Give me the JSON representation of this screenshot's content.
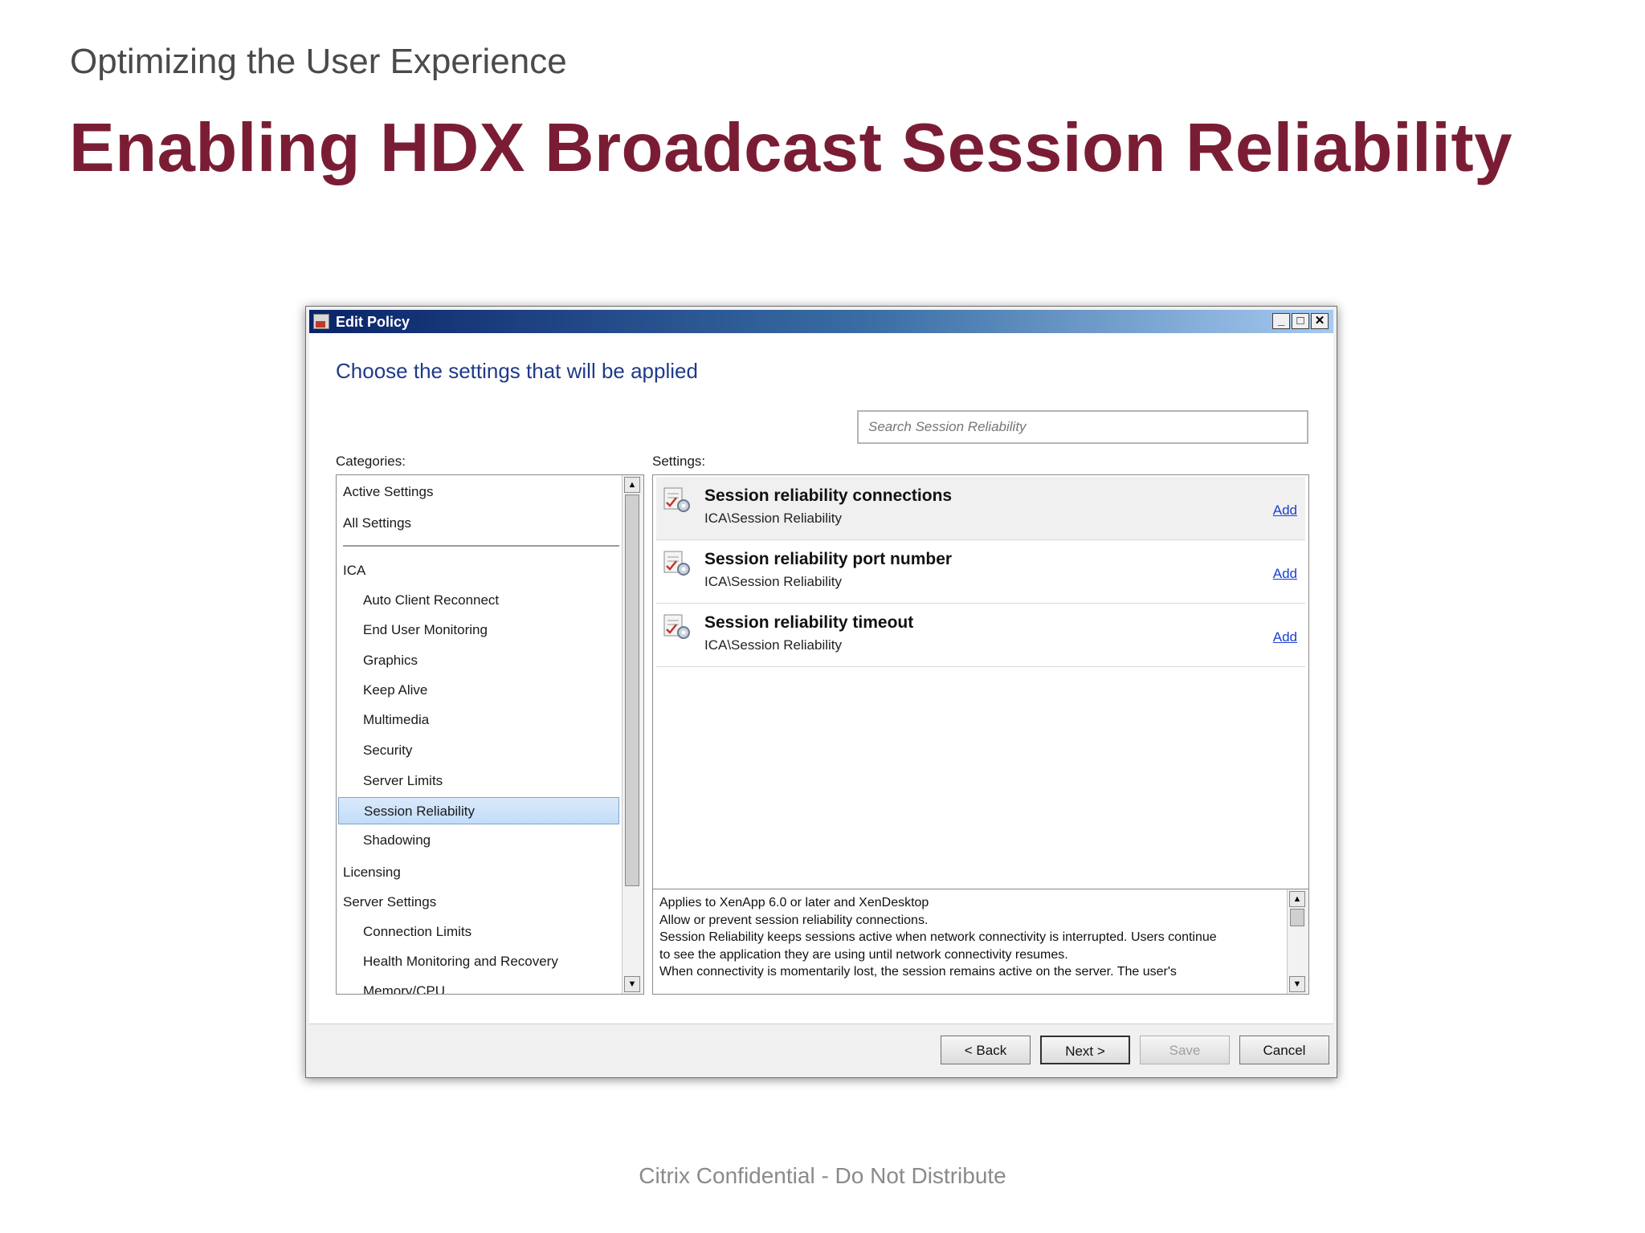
{
  "slide": {
    "subtitle": "Optimizing the User Experience",
    "title": "Enabling HDX Broadcast Session Reliability",
    "footer": "Citrix Confidential - Do Not Distribute"
  },
  "window": {
    "title": "Edit Policy",
    "controls": {
      "minimize": "_",
      "maximize": "□",
      "close": "✕"
    },
    "heading": "Choose the settings that will be applied",
    "search": {
      "placeholder": "Search Session Reliability",
      "value": ""
    },
    "categories_label": "Categories:",
    "settings_label": "Settings:",
    "categories": [
      {
        "label": "Active Settings",
        "level": 0
      },
      {
        "label": "All Settings",
        "level": 0
      },
      {
        "label": "ICA",
        "level": 0
      },
      {
        "label": "Auto Client Reconnect",
        "level": 1
      },
      {
        "label": "End User Monitoring",
        "level": 1
      },
      {
        "label": "Graphics",
        "level": 1
      },
      {
        "label": "Keep Alive",
        "level": 1
      },
      {
        "label": "Multimedia",
        "level": 1
      },
      {
        "label": "Security",
        "level": 1
      },
      {
        "label": "Server Limits",
        "level": 1
      },
      {
        "label": "Session Reliability",
        "level": 1,
        "selected": true
      },
      {
        "label": "Shadowing",
        "level": 1
      },
      {
        "label": "Licensing",
        "level": 0
      },
      {
        "label": "Server Settings",
        "level": 0
      },
      {
        "label": "Connection Limits",
        "level": 1
      },
      {
        "label": "Health Monitoring and Recovery",
        "level": 1
      },
      {
        "label": "Memory/CPU",
        "level": 1
      }
    ],
    "settings": [
      {
        "name": "Session reliability connections",
        "path": "ICA\\Session Reliability",
        "action": "Add"
      },
      {
        "name": "Session reliability port number",
        "path": "ICA\\Session Reliability",
        "action": "Add"
      },
      {
        "name": "Session reliability timeout",
        "path": "ICA\\Session Reliability",
        "action": "Add"
      }
    ],
    "description": [
      "Applies to XenApp 6.0 or later and XenDesktop",
      "Allow or prevent session reliability connections.",
      "Session Reliability keeps sessions active when network connectivity is interrupted. Users continue",
      "to see the application they are using until network connectivity resumes.",
      "When connectivity is momentarily lost, the session remains active on the server. The user's"
    ],
    "buttons": {
      "back": "< Back",
      "next": "Next >",
      "save": "Save",
      "cancel": "Cancel"
    },
    "colors": {
      "heading": "#1f3a8a",
      "link": "#1a3fd1",
      "selection": "#c2dcf8",
      "title": "#7a1d34"
    }
  }
}
